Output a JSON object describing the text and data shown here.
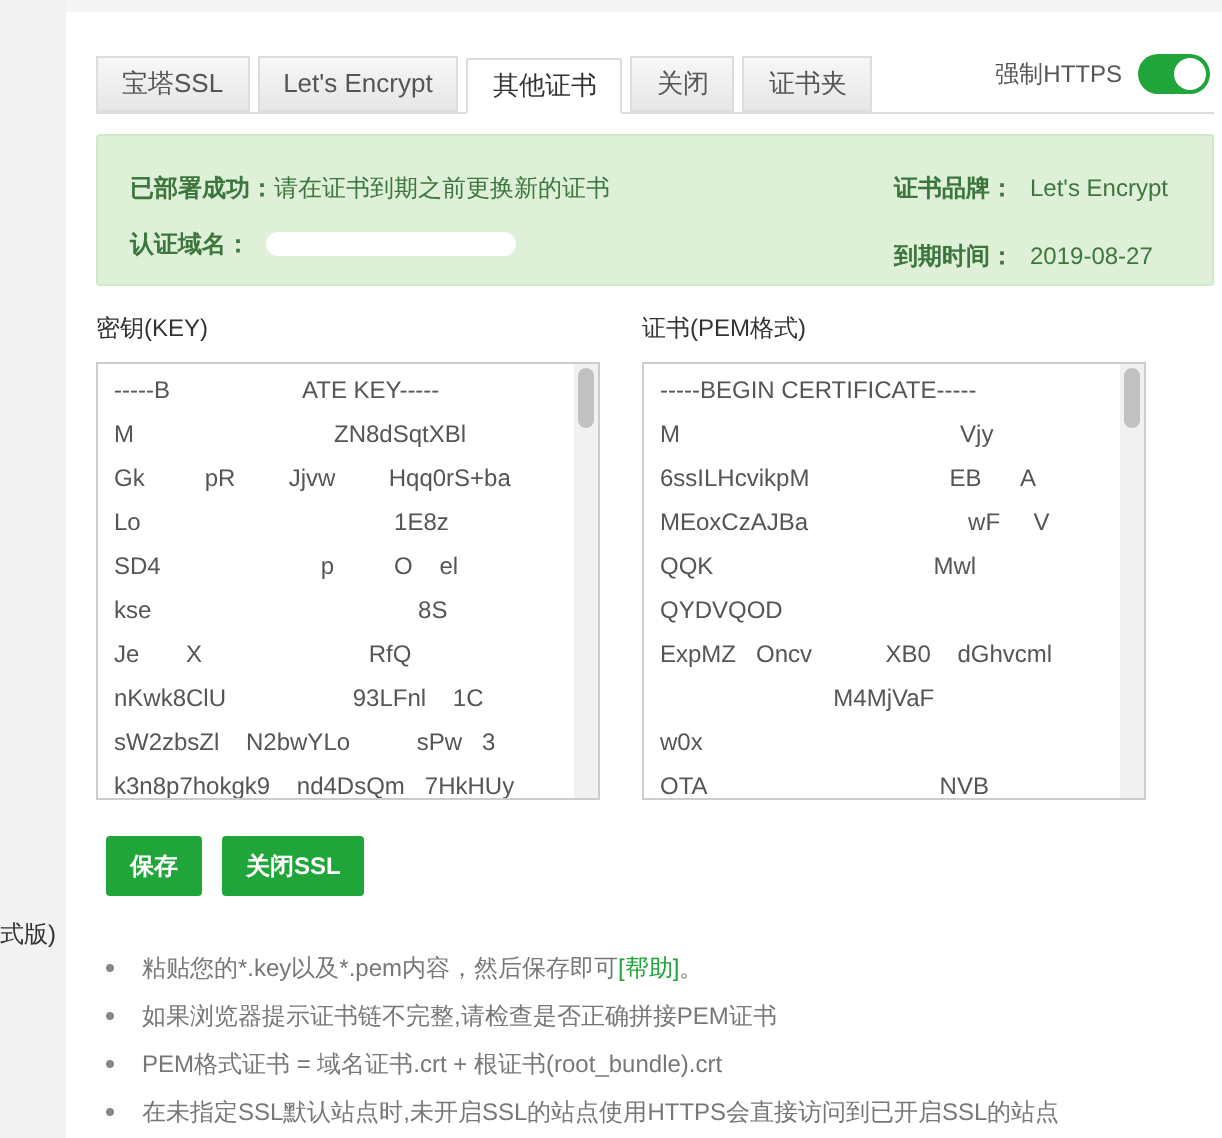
{
  "sidebar": {
    "items": [
      "式版)"
    ]
  },
  "tabs": [
    {
      "label": "宝塔SSL",
      "selected": false
    },
    {
      "label": "Let's Encrypt",
      "selected": false
    },
    {
      "label": "其他证书",
      "selected": true
    },
    {
      "label": "关闭",
      "selected": false
    },
    {
      "label": "证书夹",
      "selected": false
    }
  ],
  "force_https": {
    "label": "强制HTTPS",
    "on": true
  },
  "status": {
    "deployed_label": "已部署成功：",
    "deployed_text": "请在证书到期之前更换新的证书",
    "domain_label": "认证域名：",
    "brand_label": "证书品牌：",
    "brand": "Let's Encrypt",
    "expiry_label": "到期时间：",
    "expiry": "2019-08-27"
  },
  "key_field": {
    "label": "密钥(KEY)",
    "value": "-----B                    ATE KEY-----\nM                              ZN8dSqtXBl\nGk         pR        Jjvw        Hqq0rS+ba\nLo                                      1E8z\nSD4                        p         O    el\nkse                                        8S\nJe       X                         RfQ\nnKwk8ClU                   93LFnl    1C\nsW2zbsZl    N2bwYLo          sPw   3\nk3n8p7hokgk9    nd4DsQm   7HkHUy"
  },
  "cert_field": {
    "label": "证书(PEM格式)",
    "value": "-----BEGIN CERTIFICATE-----\nM                                          Vjy\n6ssILHcvikpM                     EB      A\nMEoxCzAJBa                        wF     V\nQQK                                 Mwl\nQYDVQOD\nExpMZ   Oncv           XB0    dGhvcml\n                          M4MjVaF\nw0x\nOTA                                   NVB"
  },
  "buttons": [
    "保存",
    "关闭SSL"
  ],
  "notes": [
    "粘贴您的*.key以及*.pem内容，然后保存即可",
    "如果浏览器提示证书链不完整,请检查是否正确拼接PEM证书",
    "PEM格式证书 = 域名证书.crt + 根证书(root_bundle).crt",
    "在未指定SSL默认站点时,未开启SSL的站点使用HTTPS会直接访问到已开启SSL的站点"
  ],
  "help_link": "[帮助]",
  "notes_end": "。"
}
